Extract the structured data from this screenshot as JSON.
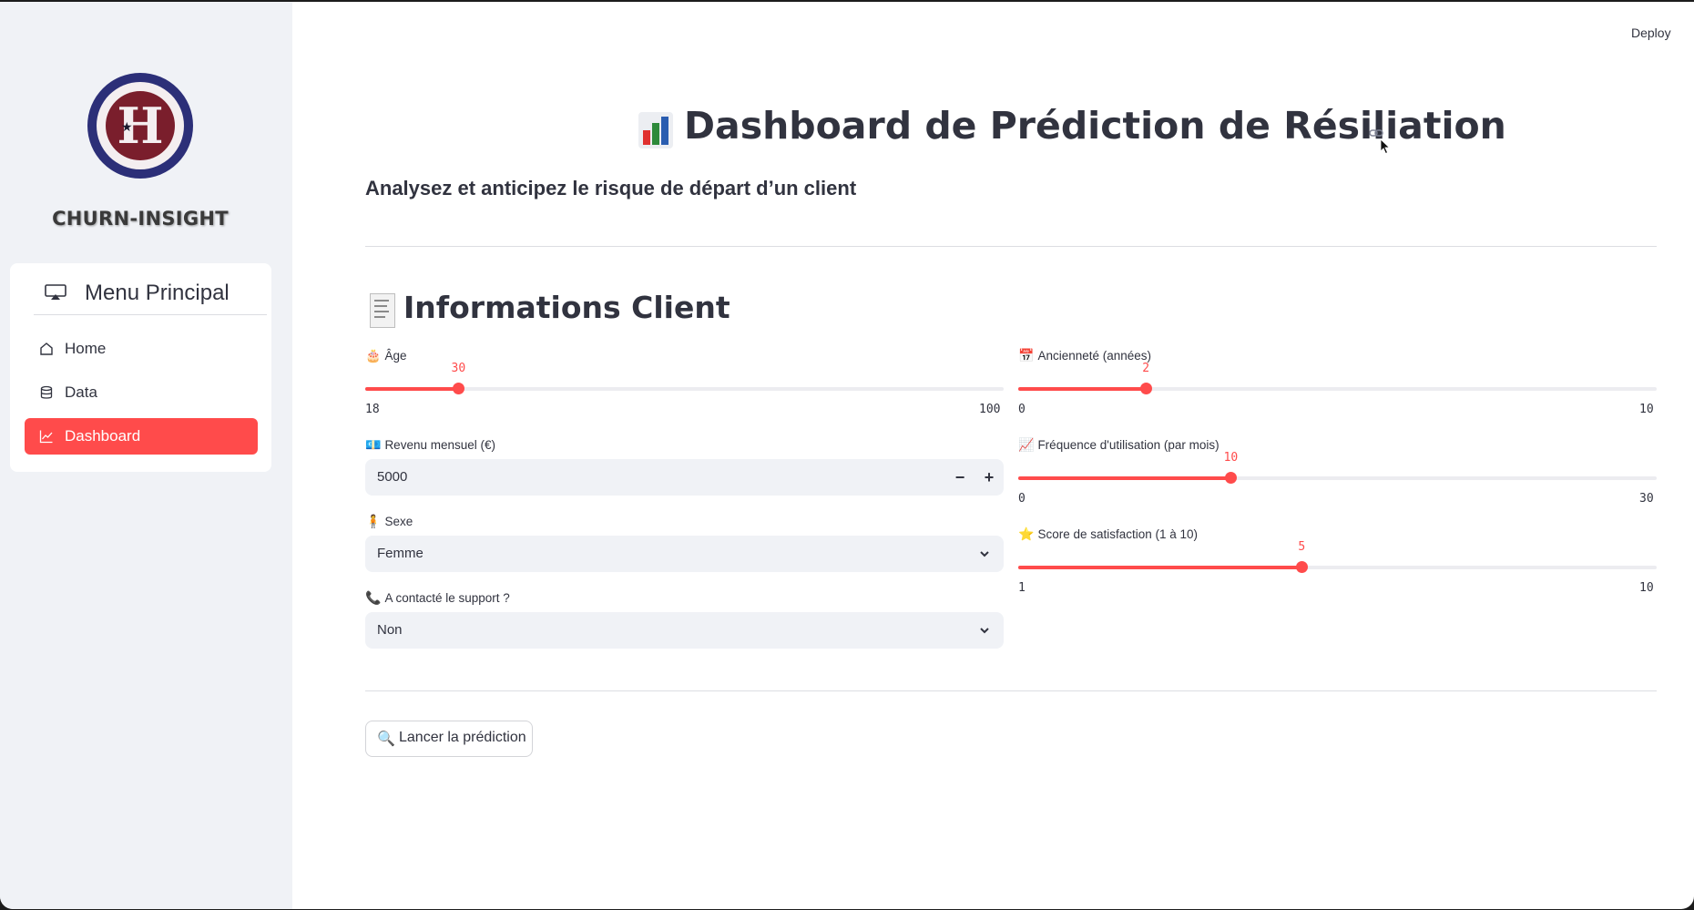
{
  "sidebar": {
    "logo_letter": "H",
    "brand": "CHURN-INSIGHT",
    "menu_title": "Menu Principal",
    "items": [
      {
        "label": "Home",
        "icon": "house-icon"
      },
      {
        "label": "Data",
        "icon": "database-icon"
      },
      {
        "label": "Dashboard",
        "icon": "chart-line-icon",
        "active": true
      }
    ]
  },
  "header": {
    "deploy": "Deploy",
    "title": "Dashboard de Prédiction de Résiliation",
    "subtitle": "Analysez et anticipez le risque de départ d’un client"
  },
  "section": {
    "title": "Informations Client"
  },
  "fields": {
    "age": {
      "label": "Âge",
      "icon": "cake-icon",
      "value": "30",
      "min": "18",
      "max": "100"
    },
    "revenue": {
      "label": "Revenu mensuel (€)",
      "icon": "money-icon",
      "value": "5000",
      "minus": "−",
      "plus": "+"
    },
    "sexe": {
      "label": "Sexe",
      "icon": "person-icon",
      "value": "Femme"
    },
    "support": {
      "label": "A contacté le support ?",
      "icon": "phone-icon",
      "value": "Non"
    },
    "anciennete": {
      "label": "Ancienneté (années)",
      "icon": "calendar-icon",
      "value": "2",
      "min": "0",
      "max": "10"
    },
    "frequence": {
      "label": "Fréquence d'utilisation (par mois)",
      "icon": "chart-up-icon",
      "value": "10",
      "min": "0",
      "max": "30"
    },
    "satisfaction": {
      "label": "Score de satisfaction (1 à 10)",
      "icon": "star-icon",
      "value": "5",
      "min": "1",
      "max": "10"
    }
  },
  "predict_button": "Lancer la prédiction",
  "colors": {
    "accent": "#ff4b4b",
    "sidebar_bg": "#f0f2f6",
    "input_bg": "#f0f2f6",
    "text": "#31333f"
  }
}
